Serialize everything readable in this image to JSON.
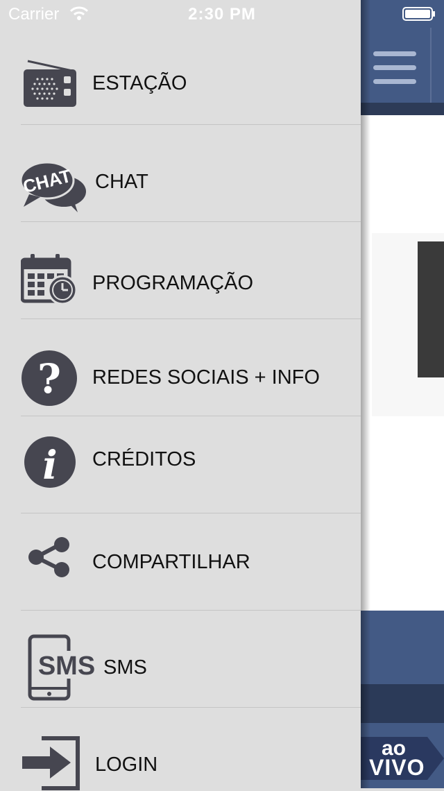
{
  "status_bar": {
    "carrier": "Carrier",
    "time": "2:30 PM"
  },
  "colors": {
    "drawer_bg": "#dedede",
    "icon_dark": "#464650",
    "brand_blue": "#435a85",
    "brand_dark": "#2b3a58"
  },
  "menu": {
    "items": [
      {
        "label": "ESTAÇÃO",
        "icon": "radio-icon"
      },
      {
        "label": "CHAT",
        "icon": "chat-bubbles-icon"
      },
      {
        "label": "PROGRAMAÇÃO",
        "icon": "calendar-clock-icon"
      },
      {
        "label": "REDES SOCIAIS + INFO",
        "icon": "question-mark-icon"
      },
      {
        "label": "CRÉDITOS",
        "icon": "info-icon"
      },
      {
        "label": "COMPARTILHAR",
        "icon": "share-icon"
      },
      {
        "label": "SMS",
        "icon": "sms-phone-icon"
      },
      {
        "label": "LOGIN",
        "icon": "login-icon"
      }
    ]
  },
  "icons_text": {
    "chat_icon_text": "CHAT",
    "sms_icon_text": "SMS"
  },
  "live_badge": {
    "line1": "ao",
    "line2": "VIVO"
  }
}
